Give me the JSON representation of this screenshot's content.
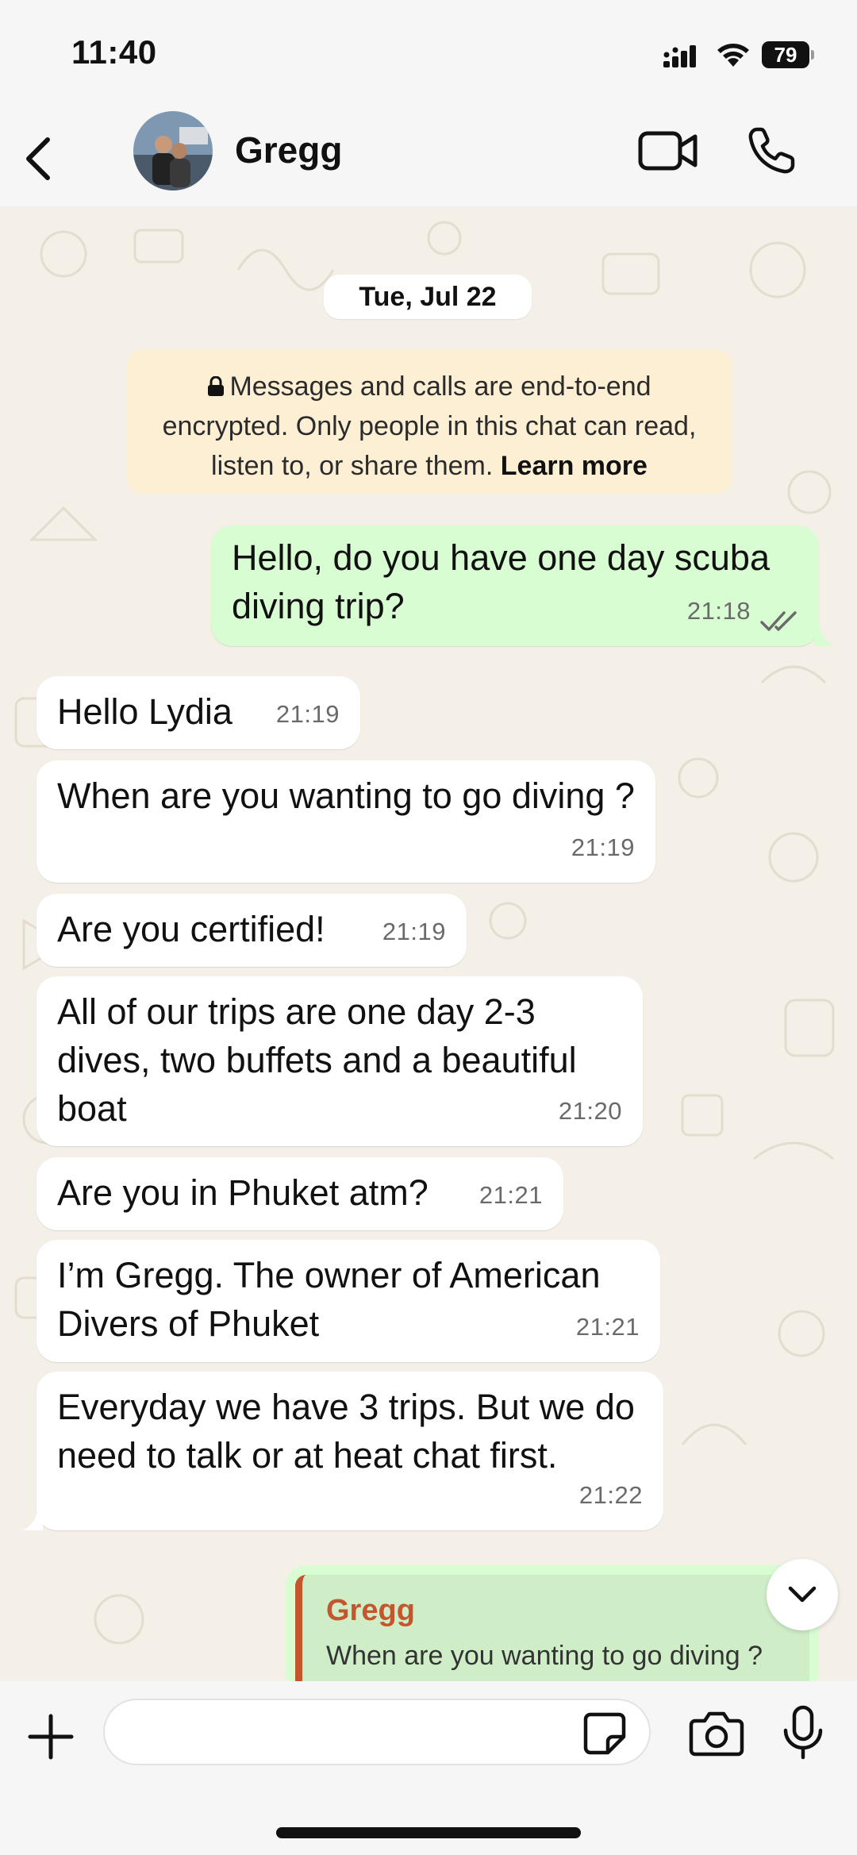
{
  "status_bar": {
    "time": "11:40",
    "battery": "79"
  },
  "header": {
    "contact_name": "Gregg",
    "back_icon": "chevron-left-icon",
    "video_icon": "video-camera-icon",
    "call_icon": "phone-icon"
  },
  "chat": {
    "date": "Tue, Jul 22",
    "encryption": {
      "text": "Messages and calls are end-to-end encrypted. Only people in this chat can read, listen to, or share them.",
      "learn_more": "Learn more"
    },
    "messages": [
      {
        "direction": "out",
        "text": "Hello, do you have one day scuba diving trip?",
        "time": "21:18",
        "status": "read"
      },
      {
        "direction": "in",
        "text": "Hello Lydia",
        "time": "21:19"
      },
      {
        "direction": "in",
        "text": "When are you wanting to go diving ?",
        "time": "21:19"
      },
      {
        "direction": "in",
        "text": "Are you certified!",
        "time": "21:19"
      },
      {
        "direction": "in",
        "text": "All of our trips are one day 2-3 dives, two buffets and a beautiful boat",
        "time": "21:20"
      },
      {
        "direction": "in",
        "text": "Are you in Phuket atm?",
        "time": "21:21"
      },
      {
        "direction": "in",
        "text": "I’m Gregg. The owner of American Divers of Phuket",
        "time": "21:21"
      },
      {
        "direction": "in",
        "text": "Everyday we have 3 trips.  But we do need to talk or at heat chat first.",
        "time": "21:22"
      }
    ],
    "reply_preview": {
      "author": "Gregg",
      "quoted_text": "When are you wanting to go diving ?"
    }
  },
  "input_bar": {
    "value": "",
    "placeholder": ""
  },
  "colors": {
    "incoming_bubble": "#ffffff",
    "outgoing_bubble": "#d9fdd3",
    "reply_accent": "#c4552c",
    "encryption_bg": "#fcefd4"
  }
}
